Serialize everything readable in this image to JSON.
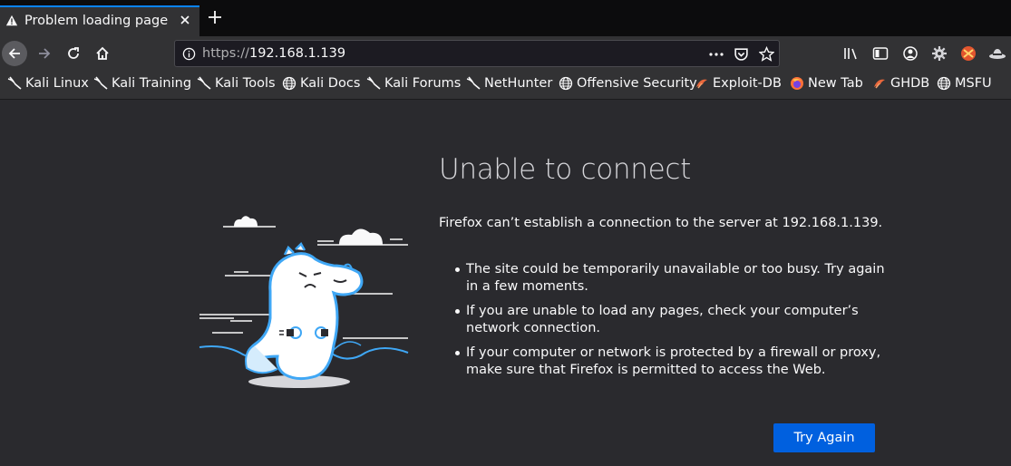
{
  "tab": {
    "title": "Problem loading page"
  },
  "urlbar": {
    "scheme": "https://",
    "host": "192.168.1.139"
  },
  "bookmarks": [
    {
      "label": "Kali Linux",
      "icon": "kali-dragon-icon"
    },
    {
      "label": "Kali Training",
      "icon": "kali-dragon-icon"
    },
    {
      "label": "Kali Tools",
      "icon": "kali-dragon-icon"
    },
    {
      "label": "Kali Docs",
      "icon": "globe-icon"
    },
    {
      "label": "Kali Forums",
      "icon": "kali-dragon-icon"
    },
    {
      "label": "NetHunter",
      "icon": "kali-dragon-icon"
    },
    {
      "label": "Offensive Security",
      "icon": "globe-icon"
    },
    {
      "label": "Exploit-DB",
      "icon": "exploit-db-icon"
    },
    {
      "label": "New Tab",
      "icon": "firefox-icon"
    },
    {
      "label": "GHDB",
      "icon": "exploit-db-icon"
    },
    {
      "label": "MSFU",
      "icon": "globe-icon"
    }
  ],
  "error": {
    "title": "Unable to connect",
    "description": "Firefox can’t establish a connection to the server at 192.168.1.139.",
    "items": [
      "The site could be temporarily unavailable or too busy. Try again in a few moments.",
      "If you are unable to load any pages, check your computer’s network connection.",
      "If your computer or network is protected by a firewall or proxy, make sure that Firefox is permitted to access the Web."
    ],
    "button": "Try Again"
  },
  "colors": {
    "accent": "#0a84ff",
    "button": "#0060df",
    "background": "#2a2a2e",
    "toolbar": "#323234"
  }
}
